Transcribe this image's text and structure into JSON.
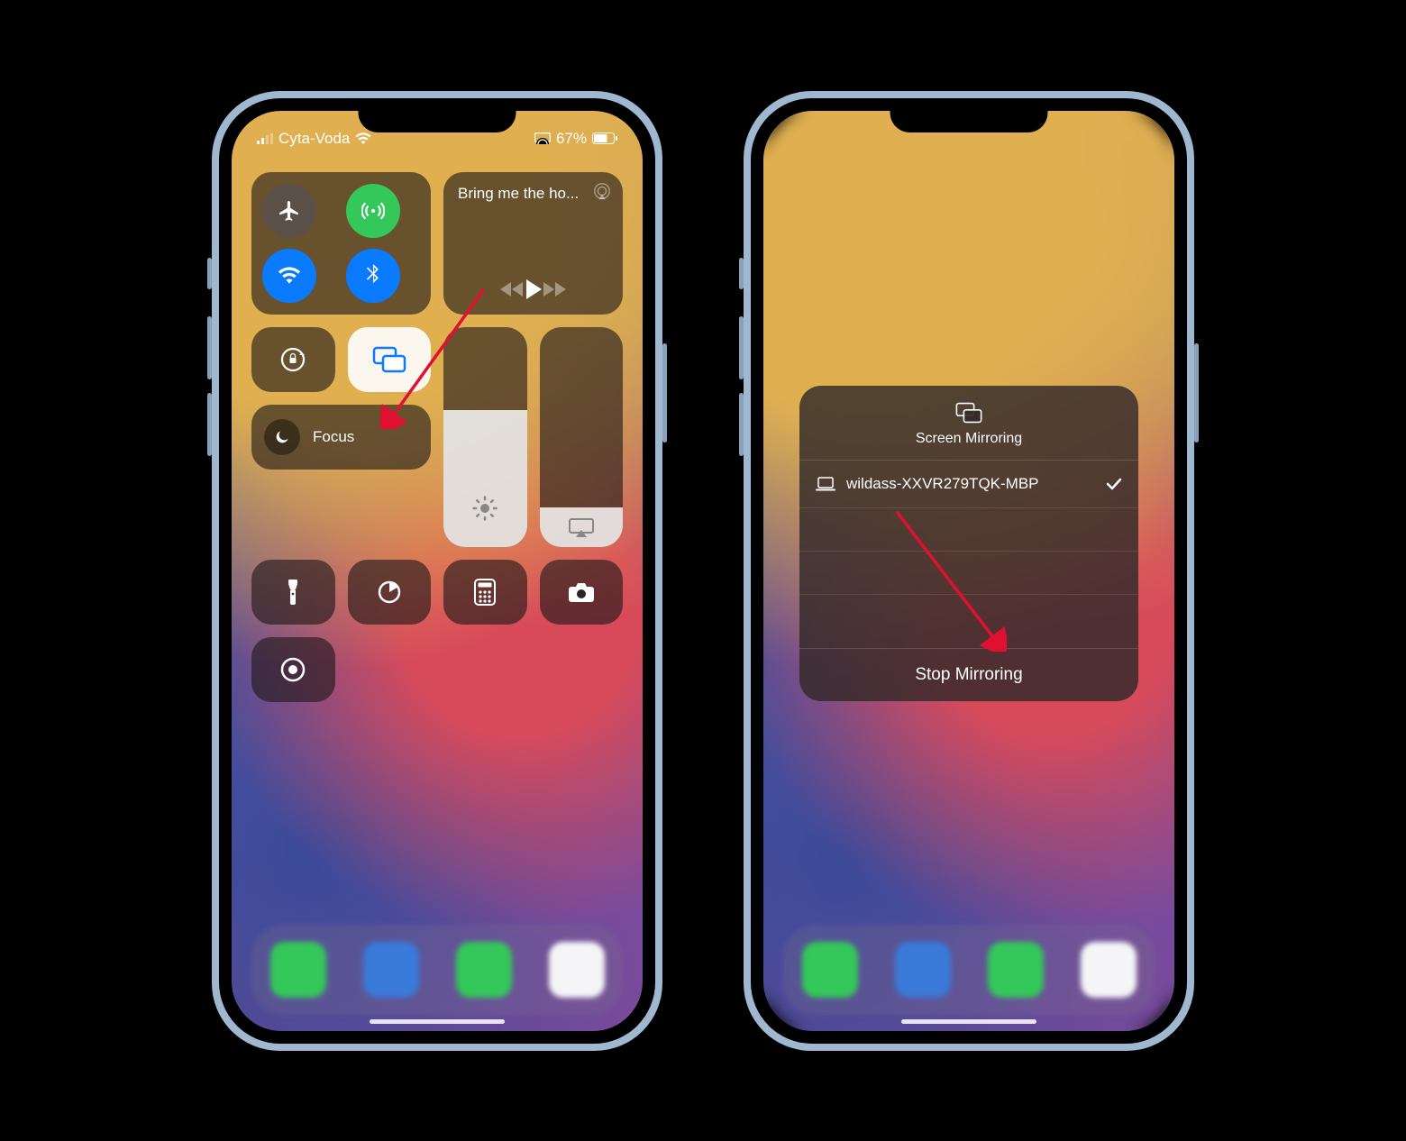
{
  "status": {
    "carrier": "Cyta-Voda",
    "battery_pct": "67%"
  },
  "music": {
    "title": "Bring me the ho..."
  },
  "focus": {
    "label": "Focus"
  },
  "sheet": {
    "title": "Screen Mirroring",
    "device": "wildass-XXVR279TQK-MBP",
    "stop": "Stop Mirroring"
  }
}
